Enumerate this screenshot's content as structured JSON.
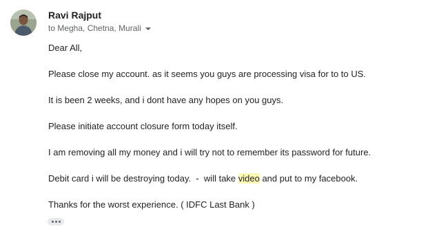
{
  "sender": {
    "name": "Ravi Rajput",
    "recipients": "to Megha, Chetna, Murali"
  },
  "body": {
    "greeting": "Dear All,",
    "line1": "Please close my account. as it seems you guys are processing visa for to to US.",
    "line2": "It is been 2 weeks, and i dont have any hopes on you guys.",
    "line3": "Please initiate account closure form today itself.",
    "line4": "I am removing all my money and i will try not to remember its password for future.",
    "line5_pre": "Debit card i will be destroying today.  -  will take ",
    "line5_highlight": "video",
    "line5_post": " and put to my facebook.",
    "line6": "Thanks for the worst experience. ( IDFC Last Bank )"
  },
  "icons": {
    "recipients_toggle": "chevron-down-icon",
    "show_trimmed": "more-horiz-icon"
  },
  "colors": {
    "highlight": "#fcf8b3",
    "secondary_text": "#5f6368"
  }
}
